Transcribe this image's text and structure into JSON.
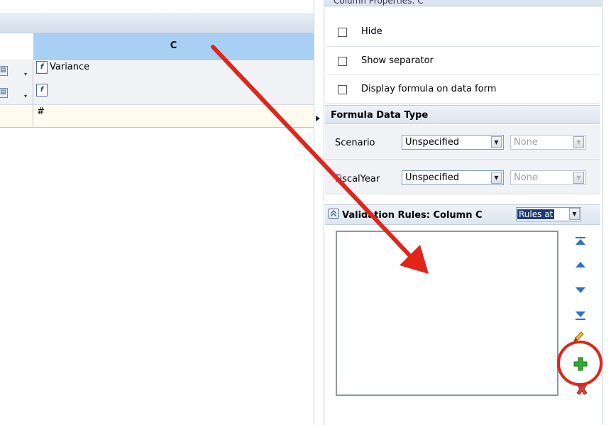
{
  "grid": {
    "column_header": "C",
    "rows": [
      {
        "stub_icon": "member-selector-icon",
        "icon": "formula-icon",
        "icon_glyph": "f",
        "text": "Variance"
      },
      {
        "stub_icon": "member-selector-icon",
        "icon": "formula-icon",
        "icon_glyph": "f",
        "text": ""
      },
      {
        "text": "#"
      }
    ]
  },
  "panel": {
    "top_title": "Column Properties: C",
    "checkboxes": [
      {
        "label": "Hide",
        "checked": false
      },
      {
        "label": "Show separator",
        "checked": false
      },
      {
        "label": "Display formula on data form",
        "checked": false
      }
    ],
    "formula_section_title": "Formula Data Type",
    "formula_rows": [
      {
        "label": "Scenario",
        "value": "Unspecified",
        "secondary": "None"
      },
      {
        "label": "FiscalYear",
        "value": "Unspecified",
        "secondary": "None"
      }
    ],
    "validation_title": "Validation Rules: Column C",
    "rules_select_value": "Rules at",
    "tools": [
      "move-top-icon",
      "move-up-icon",
      "move-down-icon",
      "move-bottom-icon",
      "edit-rule-icon",
      "add-rule-icon",
      "delete-rule-icon"
    ]
  },
  "colors": {
    "annotation_red": "#e1251b",
    "header_blue": "#a7d0f2",
    "tool_blue": "#2f6fd1",
    "add_green": "#2fae2f"
  }
}
